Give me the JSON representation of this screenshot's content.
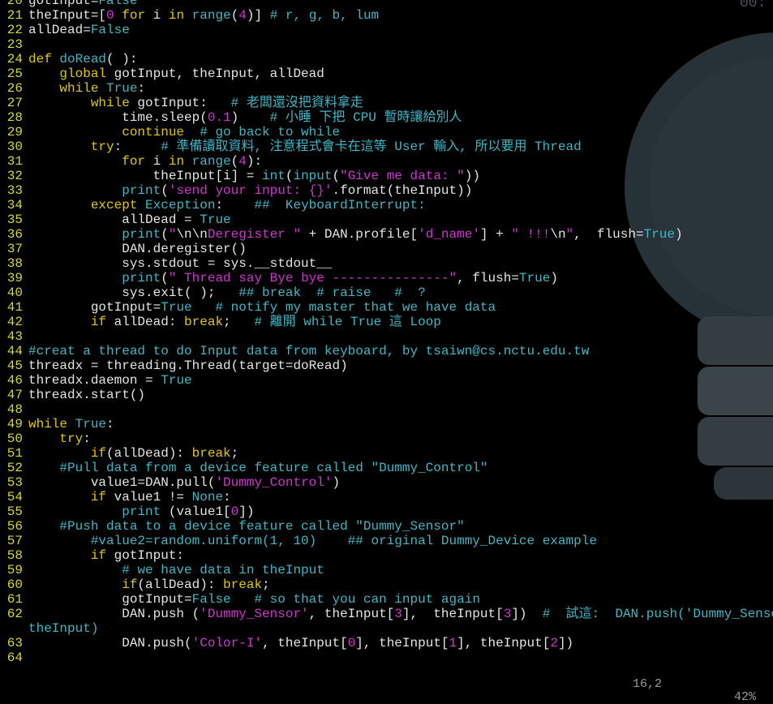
{
  "editor": {
    "lines": [
      {
        "n": "20",
        "t": [
          [
            "gotInput=",
            "t"
          ],
          [
            "False",
            "cn"
          ]
        ]
      },
      {
        "n": "21",
        "t": [
          [
            "theInput=[",
            "t"
          ],
          [
            "0",
            "num"
          ],
          [
            " ",
            "t"
          ],
          [
            "for",
            "kw"
          ],
          [
            " i ",
            "t"
          ],
          [
            "in",
            "kw"
          ],
          [
            " ",
            "t"
          ],
          [
            "range",
            "bi"
          ],
          [
            "(",
            "t"
          ],
          [
            "4",
            "num"
          ],
          [
            ")] ",
            "t"
          ],
          [
            "# r, g, b, lum",
            "cm"
          ]
        ]
      },
      {
        "n": "22",
        "t": [
          [
            "allDead=",
            "t"
          ],
          [
            "False",
            "cn"
          ]
        ]
      },
      {
        "n": "23",
        "t": []
      },
      {
        "n": "24",
        "t": [
          [
            "def",
            "kw"
          ],
          [
            " ",
            "t"
          ],
          [
            "doRead",
            "cm"
          ],
          [
            "( ):",
            "t"
          ]
        ]
      },
      {
        "n": "25",
        "t": [
          [
            "    ",
            "t"
          ],
          [
            "global",
            "kw"
          ],
          [
            " gotInput, theInput, allDead",
            "t"
          ]
        ]
      },
      {
        "n": "26",
        "t": [
          [
            "    ",
            "t"
          ],
          [
            "while",
            "kw"
          ],
          [
            " ",
            "t"
          ],
          [
            "True",
            "cn"
          ],
          [
            ":",
            "t"
          ]
        ]
      },
      {
        "n": "27",
        "t": [
          [
            "        ",
            "t"
          ],
          [
            "while",
            "kw"
          ],
          [
            " gotInput:   ",
            "t"
          ],
          [
            "# 老闆還沒把資料拿走",
            "cm"
          ]
        ]
      },
      {
        "n": "28",
        "t": [
          [
            "            time.sleep(",
            "t"
          ],
          [
            "0.1",
            "num"
          ],
          [
            ")    ",
            "t"
          ],
          [
            "# 小睡 下把 CPU 暫時讓給別人",
            "cm"
          ]
        ]
      },
      {
        "n": "29",
        "t": [
          [
            "            ",
            "t"
          ],
          [
            "continue",
            "kw"
          ],
          [
            "  ",
            "t"
          ],
          [
            "# go back to while",
            "cm"
          ]
        ]
      },
      {
        "n": "30",
        "t": [
          [
            "        ",
            "t"
          ],
          [
            "try",
            "kw"
          ],
          [
            ":     ",
            "t"
          ],
          [
            "# 準備讀取資料, 注意程式會卡在這等 User 輸入, 所以要用 Thread",
            "cm"
          ]
        ]
      },
      {
        "n": "31",
        "t": [
          [
            "            ",
            "t"
          ],
          [
            "for",
            "kw"
          ],
          [
            " i ",
            "t"
          ],
          [
            "in",
            "kw"
          ],
          [
            " ",
            "t"
          ],
          [
            "range",
            "bi"
          ],
          [
            "(",
            "t"
          ],
          [
            "4",
            "num"
          ],
          [
            "):",
            "t"
          ]
        ]
      },
      {
        "n": "32",
        "t": [
          [
            "                theInput[i] = ",
            "t"
          ],
          [
            "int",
            "bi"
          ],
          [
            "(",
            "t"
          ],
          [
            "input",
            "bi"
          ],
          [
            "(",
            "t"
          ],
          [
            "\"Give me data: \"",
            "str"
          ],
          [
            "))",
            "t"
          ]
        ]
      },
      {
        "n": "33",
        "t": [
          [
            "            ",
            "t"
          ],
          [
            "print",
            "bi"
          ],
          [
            "(",
            "t"
          ],
          [
            "'send your input: {}'",
            "str"
          ],
          [
            ".format(theInput))",
            "t"
          ]
        ]
      },
      {
        "n": "34",
        "t": [
          [
            "        ",
            "t"
          ],
          [
            "except",
            "kw"
          ],
          [
            " ",
            "t"
          ],
          [
            "Exception",
            "cn"
          ],
          [
            ":    ",
            "t"
          ],
          [
            "##  KeyboardInterrupt:",
            "cm"
          ]
        ]
      },
      {
        "n": "35",
        "t": [
          [
            "            allDead = ",
            "t"
          ],
          [
            "True",
            "cn"
          ]
        ]
      },
      {
        "n": "36",
        "t": [
          [
            "            ",
            "t"
          ],
          [
            "print",
            "bi"
          ],
          [
            "(",
            "t"
          ],
          [
            "\"",
            "str"
          ],
          [
            "\\n\\n",
            "t"
          ],
          [
            "Deregister \"",
            "str"
          ],
          [
            " + DAN.profile[",
            "t"
          ],
          [
            "'d_name'",
            "str"
          ],
          [
            "] + ",
            "t"
          ],
          [
            "\" !!!",
            "str"
          ],
          [
            "\\n",
            "t"
          ],
          [
            "\"",
            "str"
          ],
          [
            ",  flush=",
            "t"
          ],
          [
            "True",
            "cn"
          ],
          [
            ")",
            "t"
          ]
        ]
      },
      {
        "n": "37",
        "t": [
          [
            "            DAN.deregister()",
            "t"
          ]
        ]
      },
      {
        "n": "38",
        "t": [
          [
            "            sys.stdout = sys.__stdout__",
            "t"
          ]
        ]
      },
      {
        "n": "39",
        "t": [
          [
            "            ",
            "t"
          ],
          [
            "print",
            "bi"
          ],
          [
            "(",
            "t"
          ],
          [
            "\" Thread say Bye bye ---------------\"",
            "str"
          ],
          [
            ", flush=",
            "t"
          ],
          [
            "True",
            "cn"
          ],
          [
            ")",
            "t"
          ]
        ]
      },
      {
        "n": "40",
        "t": [
          [
            "            sys.exit( );   ",
            "t"
          ],
          [
            "## break  # raise   #  ?",
            "cm"
          ]
        ]
      },
      {
        "n": "41",
        "t": [
          [
            "        gotInput=",
            "t"
          ],
          [
            "True",
            "cn"
          ],
          [
            "   ",
            "t"
          ],
          [
            "# notify my master that we have data",
            "cm"
          ]
        ]
      },
      {
        "n": "42",
        "t": [
          [
            "        ",
            "t"
          ],
          [
            "if",
            "kw"
          ],
          [
            " allDead: ",
            "t"
          ],
          [
            "break",
            "kw"
          ],
          [
            ";   ",
            "t"
          ],
          [
            "# 離開 while True 這 Loop",
            "cm"
          ]
        ]
      },
      {
        "n": "43",
        "t": []
      },
      {
        "n": "44",
        "t": [
          [
            "#creat a thread to do Input data from keyboard, by tsaiwn@cs.nctu.edu.tw",
            "cm"
          ]
        ]
      },
      {
        "n": "45",
        "t": [
          [
            "threadx = threading.Thread(target=doRead)",
            "t"
          ]
        ]
      },
      {
        "n": "46",
        "t": [
          [
            "threadx.daemon = ",
            "t"
          ],
          [
            "True",
            "cn"
          ]
        ]
      },
      {
        "n": "47",
        "t": [
          [
            "threadx.start()",
            "t"
          ]
        ]
      },
      {
        "n": "48",
        "t": []
      },
      {
        "n": "49",
        "t": [
          [
            "while",
            "kw"
          ],
          [
            " ",
            "t"
          ],
          [
            "True",
            "cn"
          ],
          [
            ":",
            "t"
          ]
        ]
      },
      {
        "n": "50",
        "t": [
          [
            "    ",
            "t"
          ],
          [
            "try",
            "kw"
          ],
          [
            ":",
            "t"
          ]
        ]
      },
      {
        "n": "51",
        "t": [
          [
            "        ",
            "t"
          ],
          [
            "if",
            "kw"
          ],
          [
            "(allDead): ",
            "t"
          ],
          [
            "break",
            "kw"
          ],
          [
            ";",
            "t"
          ]
        ]
      },
      {
        "n": "52",
        "t": [
          [
            "    ",
            "t"
          ],
          [
            "#Pull data from a device feature called \"Dummy_Control\"",
            "cm"
          ]
        ]
      },
      {
        "n": "53",
        "t": [
          [
            "        value1=DAN.pull(",
            "t"
          ],
          [
            "'Dummy_Control'",
            "str"
          ],
          [
            ")",
            "t"
          ]
        ]
      },
      {
        "n": "54",
        "t": [
          [
            "        ",
            "t"
          ],
          [
            "if",
            "kw"
          ],
          [
            " value1 != ",
            "t"
          ],
          [
            "None",
            "cn"
          ],
          [
            ":",
            "t"
          ]
        ]
      },
      {
        "n": "55",
        "t": [
          [
            "            ",
            "t"
          ],
          [
            "print",
            "bi"
          ],
          [
            " (value1[",
            "t"
          ],
          [
            "0",
            "num"
          ],
          [
            "])",
            "t"
          ]
        ]
      },
      {
        "n": "56",
        "t": [
          [
            "    ",
            "t"
          ],
          [
            "#Push data to a device feature called \"Dummy_Sensor\"",
            "cm"
          ]
        ]
      },
      {
        "n": "57",
        "t": [
          [
            "        ",
            "t"
          ],
          [
            "#value2=random.uniform(1, 10)    ## original Dummy_Device example",
            "cm"
          ]
        ]
      },
      {
        "n": "58",
        "t": [
          [
            "        ",
            "t"
          ],
          [
            "if",
            "kw"
          ],
          [
            " gotInput:",
            "t"
          ]
        ]
      },
      {
        "n": "59",
        "t": [
          [
            "            ",
            "t"
          ],
          [
            "# we have data in theInput",
            "cm"
          ]
        ]
      },
      {
        "n": "60",
        "t": [
          [
            "            ",
            "t"
          ],
          [
            "if",
            "kw"
          ],
          [
            "(allDead): ",
            "t"
          ],
          [
            "break",
            "kw"
          ],
          [
            ";",
            "t"
          ]
        ]
      },
      {
        "n": "61",
        "t": [
          [
            "            gotInput=",
            "t"
          ],
          [
            "False",
            "cn"
          ],
          [
            "   ",
            "t"
          ],
          [
            "# so that you can input again",
            "cm"
          ]
        ]
      },
      {
        "n": "62",
        "t": [
          [
            "            DAN.push (",
            "t"
          ],
          [
            "'Dummy_Sensor'",
            "str"
          ],
          [
            ", theInput[",
            "t"
          ],
          [
            "3",
            "num"
          ],
          [
            "],  theInput[",
            "t"
          ],
          [
            "3",
            "num"
          ],
          [
            "])  ",
            "t"
          ],
          [
            "#  試這:  DAN.push('Dummy_Sensor',",
            "cm"
          ]
        ]
      },
      {
        "n": "",
        "t": [
          [
            "theInput)",
            "cm"
          ]
        ]
      },
      {
        "n": "63",
        "t": [
          [
            "            DAN.push(",
            "t"
          ],
          [
            "'Color-I'",
            "str"
          ],
          [
            ", theInput[",
            "t"
          ],
          [
            "0",
            "num"
          ],
          [
            "], theInput[",
            "t"
          ],
          [
            "1",
            "num"
          ],
          [
            "], theInput[",
            "t"
          ],
          [
            "2",
            "num"
          ],
          [
            "])",
            "t"
          ]
        ]
      },
      {
        "n": "64",
        "t": []
      }
    ]
  },
  "status": {
    "position": "16,2",
    "percent": "42%"
  },
  "corner_text": "00:"
}
